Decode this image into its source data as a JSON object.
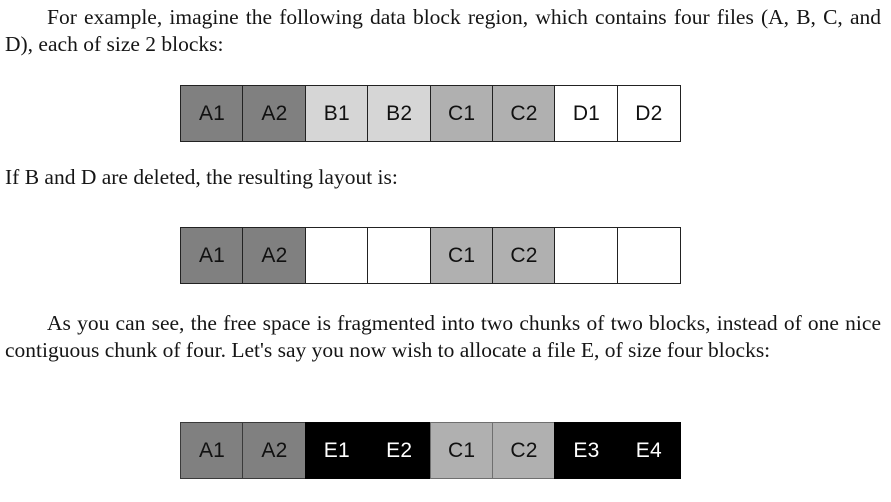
{
  "document": {
    "paragraphs": [
      {
        "id": "intro",
        "indent": true,
        "text": "For example, imagine the following data block region, which contains four files (A, B, C, and D), each of size 2 blocks:"
      },
      {
        "id": "deleted",
        "indent": false,
        "text": "If B and D are deleted, the resulting layout is:"
      },
      {
        "id": "fragmented",
        "indent": true,
        "text": "As you can see, the free space is fragmented into two chunks of two blocks, instead of one nice contiguous chunk of four. Let's say you now wish to allocate a file E, of size four blocks:"
      }
    ]
  },
  "colors": {
    "file_a": "#808080",
    "file_b": "#d6d6d6",
    "file_c": "#b0b0b0",
    "file_d": "#ffffff",
    "file_e": "#000000",
    "free": "#ffffff",
    "border": "#222222",
    "text": "#151515"
  },
  "diagrams": [
    {
      "id": "initial-layout",
      "caption_ref": "intro",
      "blocks": [
        {
          "label": "A1",
          "file": "A",
          "style": "c-dark"
        },
        {
          "label": "A2",
          "file": "A",
          "style": "c-dark"
        },
        {
          "label": "B1",
          "file": "B",
          "style": "c-light"
        },
        {
          "label": "B2",
          "file": "B",
          "style": "c-light"
        },
        {
          "label": "C1",
          "file": "C",
          "style": "c-mid"
        },
        {
          "label": "C2",
          "file": "C",
          "style": "c-mid"
        },
        {
          "label": "D1",
          "file": "D",
          "style": "c-white"
        },
        {
          "label": "D2",
          "file": "D",
          "style": "c-white"
        }
      ]
    },
    {
      "id": "after-delete-layout",
      "caption_ref": "deleted",
      "blocks": [
        {
          "label": "A1",
          "file": "A",
          "style": "c-dark"
        },
        {
          "label": "A2",
          "file": "A",
          "style": "c-dark"
        },
        {
          "label": "",
          "file": "free",
          "style": "c-white"
        },
        {
          "label": "",
          "file": "free",
          "style": "c-white"
        },
        {
          "label": "C1",
          "file": "C",
          "style": "c-mid"
        },
        {
          "label": "C2",
          "file": "C",
          "style": "c-mid"
        },
        {
          "label": "",
          "file": "free",
          "style": "c-white"
        },
        {
          "label": "",
          "file": "free",
          "style": "c-white"
        }
      ]
    },
    {
      "id": "after-allocate-e-layout",
      "caption_ref": "fragmented",
      "blocks": [
        {
          "label": "A1",
          "file": "A",
          "style": "c-dark"
        },
        {
          "label": "A2",
          "file": "A",
          "style": "c-dark"
        },
        {
          "label": "E1",
          "file": "E",
          "style": "c-black pair-left"
        },
        {
          "label": "E2",
          "file": "E",
          "style": "c-black pair-right"
        },
        {
          "label": "C1",
          "file": "C",
          "style": "c-mid"
        },
        {
          "label": "C2",
          "file": "C",
          "style": "c-mid"
        },
        {
          "label": "E3",
          "file": "E",
          "style": "c-black pair-left"
        },
        {
          "label": "E4",
          "file": "E",
          "style": "c-black pair-right"
        }
      ]
    }
  ]
}
